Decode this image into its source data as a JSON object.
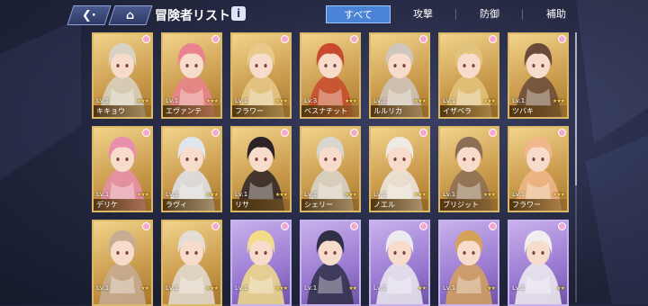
{
  "header": {
    "back_icon": "back-arrow-icon",
    "home_icon": "home-icon",
    "title": "冒険者リスト",
    "info_label": "i"
  },
  "tabs": [
    {
      "label": "すべて",
      "active": true
    },
    {
      "label": "攻撃",
      "active": false
    },
    {
      "label": "防御",
      "active": false
    },
    {
      "label": "補助",
      "active": false
    }
  ],
  "cards": [
    {
      "level": "Lv.1",
      "name": "キキョウ",
      "stars": "★★★",
      "frame": "gold",
      "hair": "#d8d2c4"
    },
    {
      "level": "Lv.1",
      "name": "エヴァンテ",
      "stars": "★★★",
      "frame": "gold",
      "hair": "#e9848e"
    },
    {
      "level": "Lv.1",
      "name": "フラワー",
      "stars": "★★★",
      "frame": "gold",
      "hair": "#e8c98a"
    },
    {
      "level": "Lv.3",
      "name": "ベスナチット",
      "stars": "★★★",
      "frame": "gold",
      "hair": "#c94a2e"
    },
    {
      "level": "Lv.1",
      "name": "ルルリカ",
      "stars": "★★★",
      "frame": "gold",
      "hair": "#cfc6bd"
    },
    {
      "level": "Lv.1",
      "name": "イザベラ",
      "stars": "★★★",
      "frame": "gold",
      "hair": "#e3c47c"
    },
    {
      "level": "Lv.1",
      "name": "ツバキ",
      "stars": "★★★",
      "frame": "gold",
      "hair": "#6a4a38"
    },
    {
      "level": "Lv.1",
      "name": "デリケ",
      "stars": "★★★",
      "frame": "gold",
      "hair": "#e98fae"
    },
    {
      "level": "Lv.1",
      "name": "ラヴィ",
      "stars": "★★★",
      "frame": "gold",
      "hair": "#dfe4ee"
    },
    {
      "level": "Lv.1",
      "name": "リサ",
      "stars": "★★★",
      "frame": "gold",
      "hair": "#2b2326"
    },
    {
      "level": "Lv.1",
      "name": "シェリー",
      "stars": "★★★",
      "frame": "gold",
      "hair": "#d9d6cf"
    },
    {
      "level": "Lv.1",
      "name": "ノエル",
      "stars": "★★★",
      "frame": "gold",
      "hair": "#eeeae4"
    },
    {
      "level": "Lv.1",
      "name": "ブリジット",
      "stars": "★★★",
      "frame": "gold",
      "hair": "#8c6d55"
    },
    {
      "level": "Lv.1",
      "name": "フラワー",
      "stars": "★★★",
      "frame": "gold",
      "hair": "#f0b78a"
    },
    {
      "level": "Lv.1",
      "name": "",
      "stars": "★★",
      "frame": "gold",
      "hair": "#c6ad94"
    },
    {
      "level": "Lv.1",
      "name": "",
      "stars": "★★★",
      "frame": "gold",
      "hair": "#e3ddd5"
    },
    {
      "level": "Lv.1",
      "name": "",
      "stars": "★★★",
      "frame": "purple",
      "hair": "#f2dc88"
    },
    {
      "level": "Lv.1",
      "name": "",
      "stars": "★★",
      "frame": "purple",
      "hair": "#2f3048"
    },
    {
      "level": "Lv.1",
      "name": "",
      "stars": "★★",
      "frame": "purple",
      "hair": "#ecebef"
    },
    {
      "level": "Lv.1",
      "name": "",
      "stars": "★★",
      "frame": "purple",
      "hair": "#d6a25a"
    },
    {
      "level": "Lv.1",
      "name": "",
      "stars": "★★",
      "frame": "purple",
      "hair": "#f1eef0"
    }
  ],
  "card_corner_icon": "flower-badge-icon",
  "colors": {
    "tab_active": "#4b83d6",
    "gold_frame": "#d9b86a",
    "purple_frame": "#c6b2ef",
    "star": "#ffd84a"
  }
}
